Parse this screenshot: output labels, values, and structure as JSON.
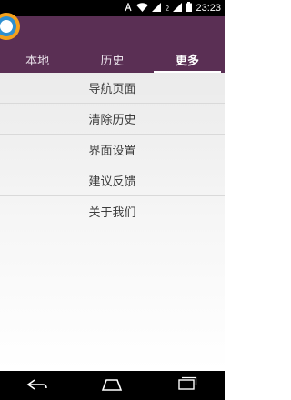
{
  "status_bar": {
    "network_label": "2",
    "time": "23:23",
    "icons": [
      "notification-icon",
      "wifi-icon",
      "signal-icon",
      "signal-icon",
      "battery-icon"
    ]
  },
  "app": {
    "accent_color": "#5a2f54",
    "tabs": [
      {
        "label": "本地",
        "active": false
      },
      {
        "label": "历史",
        "active": false
      },
      {
        "label": "更多",
        "active": true
      }
    ]
  },
  "menu": {
    "items": [
      "导航页面",
      "清除历史",
      "界面设置",
      "建议反馈",
      "关于我们"
    ]
  },
  "nav_bar": {
    "icons": [
      "back-icon",
      "home-icon",
      "recents-icon"
    ]
  }
}
